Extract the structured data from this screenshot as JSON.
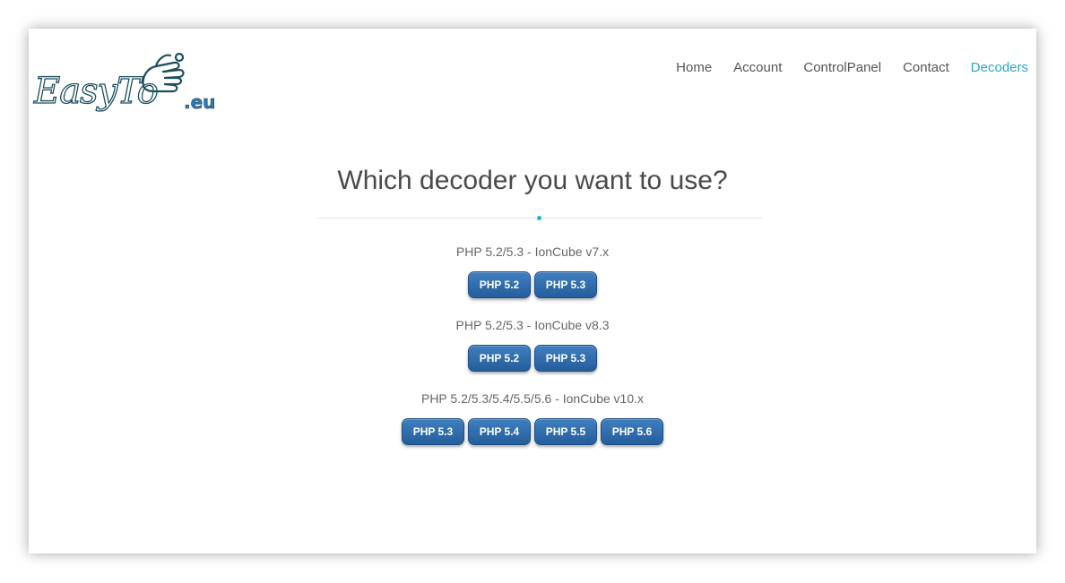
{
  "logo": {
    "text": "EasyTo",
    "ext": ".eu",
    "icon": "pointing-hand-icon"
  },
  "nav": {
    "items": [
      {
        "label": "Home"
      },
      {
        "label": "Account"
      },
      {
        "label": "ControlPanel"
      },
      {
        "label": "Contact"
      },
      {
        "label": "Decoders",
        "active": true
      }
    ]
  },
  "main": {
    "title": "Which decoder you want to use?",
    "sections": [
      {
        "label": "PHP 5.2/5.3 - IonCube v7.x",
        "buttons": [
          "PHP 5.2",
          "PHP 5.3"
        ]
      },
      {
        "label": "PHP 5.2/5.3 - IonCube v8.3",
        "buttons": [
          "PHP 5.2",
          "PHP 5.3"
        ]
      },
      {
        "label": "PHP 5.2/5.3/5.4/5.5/5.6 - IonCube v10.x",
        "buttons": [
          "PHP 5.3",
          "PHP 5.4",
          "PHP 5.5",
          "PHP 5.6"
        ]
      }
    ]
  },
  "colors": {
    "accent": "#2aa8c6",
    "button": "#2c6aab",
    "text": "#4a4a4a"
  }
}
